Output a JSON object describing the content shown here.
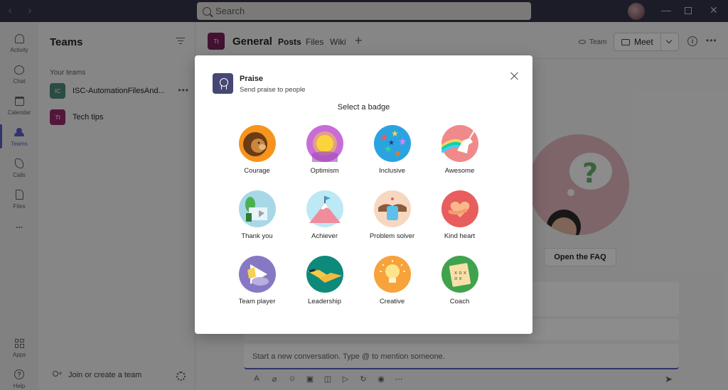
{
  "titlebar": {
    "search_placeholder": "Search"
  },
  "rail": {
    "items": [
      {
        "label": "Activity"
      },
      {
        "label": "Chat"
      },
      {
        "label": "Calendar"
      },
      {
        "label": "Teams"
      },
      {
        "label": "Calls"
      },
      {
        "label": "Files"
      },
      {
        "label": "..."
      },
      {
        "label": "Apps"
      },
      {
        "label": "Help"
      }
    ],
    "active_color": "#5b5fc7"
  },
  "teams_pane": {
    "title": "Teams",
    "section_label": "Your teams",
    "teams": [
      {
        "initials": "IC",
        "name": "ISC-AutomationFilesAnd...",
        "color": "#4e8a7b"
      },
      {
        "initials": "Tt",
        "name": "Tech tips",
        "color": "#9a2a6e"
      }
    ],
    "more": "•••",
    "join_label": "Join or create a team"
  },
  "channel": {
    "avatar_initials": "Tt",
    "name": "General",
    "tabs": [
      "Posts",
      "Files",
      "Wiki"
    ],
    "plus": "+",
    "team_button": "Team",
    "meet_button": "Meet",
    "info": "i",
    "more": "•••",
    "faq_button": "Open the FAQ",
    "compose_placeholder": "Start a new conversation. Type @ to mention someone."
  },
  "dialog": {
    "app_name": "Praise",
    "app_subtitle": "Send praise to people",
    "select_label": "Select a badge",
    "badges": [
      {
        "label": "Courage",
        "icon": "lion-icon"
      },
      {
        "label": "Optimism",
        "icon": "sun-icon"
      },
      {
        "label": "Inclusive",
        "icon": "stars-icon"
      },
      {
        "label": "Awesome",
        "icon": "unicorn-icon"
      },
      {
        "label": "Thank you",
        "icon": "gift-card-icon"
      },
      {
        "label": "Achiever",
        "icon": "mountain-flag-icon"
      },
      {
        "label": "Problem solver",
        "icon": "puzzle-icon"
      },
      {
        "label": "Kind heart",
        "icon": "heart-hand-icon"
      },
      {
        "label": "Team player",
        "icon": "play-hands-icon"
      },
      {
        "label": "Leadership",
        "icon": "handshake-icon"
      },
      {
        "label": "Creative",
        "icon": "lightbulb-icon"
      },
      {
        "label": "Coach",
        "icon": "clipboard-icon"
      }
    ]
  }
}
